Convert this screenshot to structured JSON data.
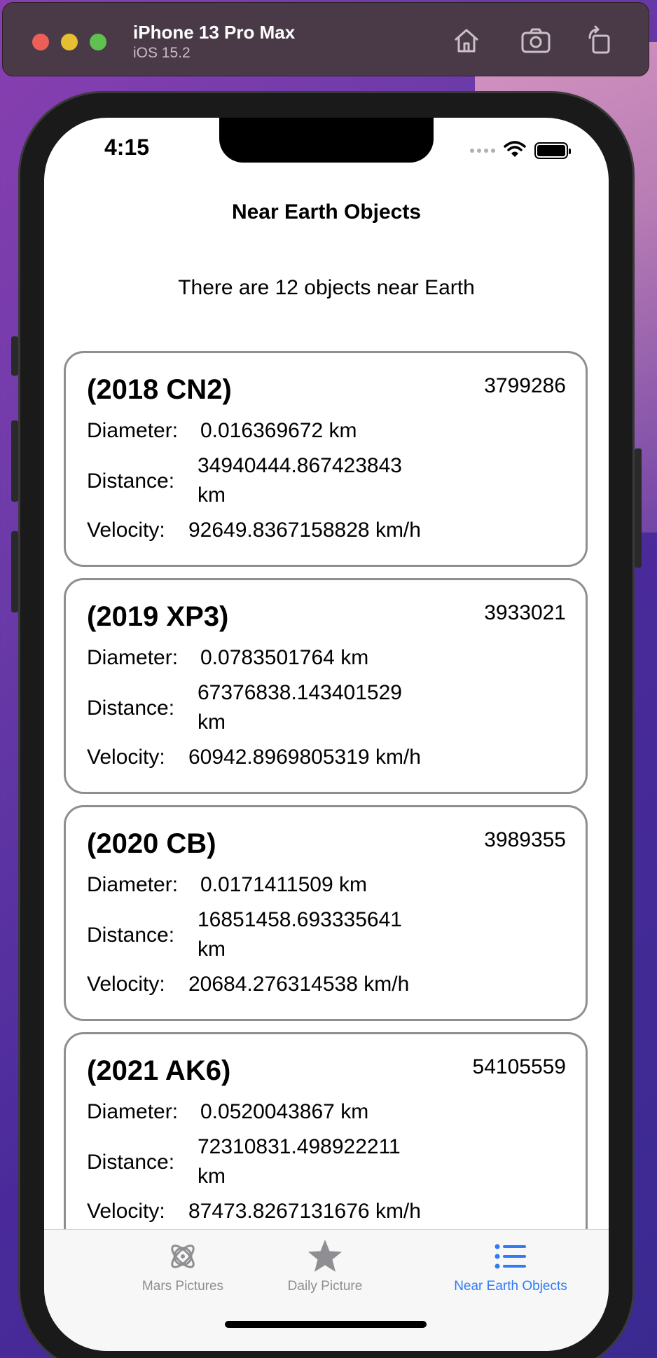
{
  "simulator": {
    "device_name": "iPhone 13 Pro Max",
    "os_version": "iOS 15.2",
    "buttons": [
      "home-icon",
      "screenshot-icon",
      "rotate-icon"
    ]
  },
  "status_bar": {
    "time": "4:15"
  },
  "nav": {
    "title": "Near Earth Objects"
  },
  "summary": "There are 12 objects near Earth",
  "labels": {
    "diameter": "Diameter:",
    "distance": "Distance:",
    "velocity": "Velocity:"
  },
  "objects": [
    {
      "name": "(2018 CN2)",
      "id": "3799286",
      "diameter": "0.016369672 km",
      "distance": "34940444.867423843 km",
      "velocity": "92649.8367158828 km/h"
    },
    {
      "name": "(2019 XP3)",
      "id": "3933021",
      "diameter": "0.0783501764 km",
      "distance": "67376838.143401529 km",
      "velocity": "60942.8969805319 km/h"
    },
    {
      "name": "(2020 CB)",
      "id": "3989355",
      "diameter": "0.0171411509 km",
      "distance": "16851458.693335641 km",
      "velocity": "20684.276314538 km/h"
    },
    {
      "name": "(2021 AK6)",
      "id": "54105559",
      "diameter": "0.0520043867 km",
      "distance": "72310831.498922211 km",
      "velocity": "87473.8267131676 km/h"
    }
  ],
  "tabs": [
    {
      "label": "Mars Pictures",
      "icon": "atom-icon",
      "active": false
    },
    {
      "label": "Daily Picture",
      "icon": "star-icon",
      "active": false
    },
    {
      "label": "Near Earth Objects",
      "icon": "list-icon",
      "active": true
    }
  ],
  "colors": {
    "active_tab": "#2f7cf6",
    "inactive_tab": "#8e8e93",
    "card_border": "#8e8e93"
  }
}
